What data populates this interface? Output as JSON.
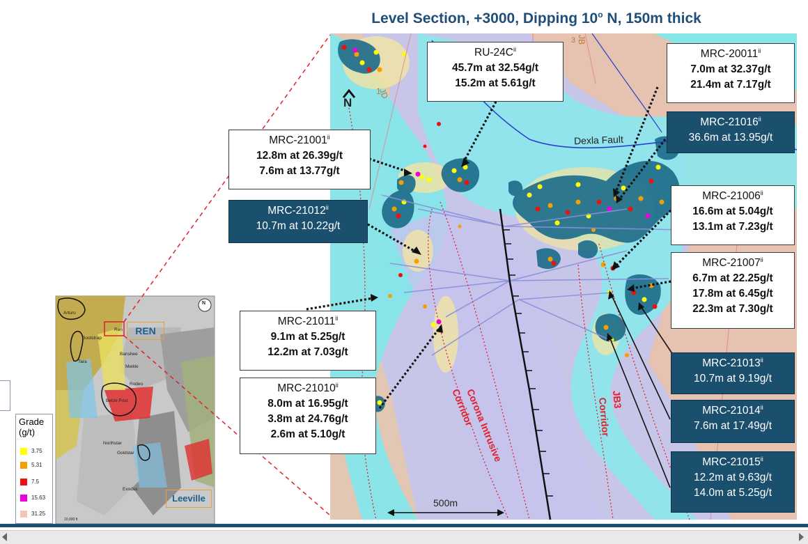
{
  "title": "Level Section, +3000, Dipping 10",
  "title_sup": "o",
  "title_tail": " N, 150m thick",
  "north_label": "N",
  "scale_label": "500m",
  "fault_label": "Dexla Fault",
  "corridor_labels": {
    "corona_1": "Corona Intrusive",
    "corona_2": "Corridor",
    "jb3_1": "JB3",
    "jb3_2": "Corridor",
    "jd": "JD",
    "jd_num": "1",
    "jb": "JB",
    "jb_num": "3"
  },
  "inset": {
    "ren_label": "REN",
    "leeville_label": "Leeville",
    "place_labels": [
      "Arturo",
      "Bootstrap",
      "Tara",
      "Ren",
      "Banshee",
      "Meikle",
      "Rodeo",
      "Betze Post",
      "Northstar",
      "Goldstar",
      "Exodus"
    ],
    "north_symbol": "N",
    "scale_text": "10,000 ft"
  },
  "legend": {
    "title_1": "Grade",
    "title_2": "(g/t)",
    "items": [
      {
        "label": "3.75",
        "color": "#ffff00"
      },
      {
        "label": "5.31",
        "color": "#f5a000"
      },
      {
        "label": "7.5",
        "color": "#ee1111"
      },
      {
        "label": "15.63",
        "color": "#ee00dd"
      },
      {
        "label": "31.25",
        "color": "#f4c6b8"
      }
    ]
  },
  "callouts": [
    {
      "id": "ru24c",
      "name": "RU-24C",
      "sup": "ii",
      "lines": [
        "45.7m at 32.54g/t",
        "15.2m at 5.61g/t"
      ],
      "style": "light"
    },
    {
      "id": "mrc20011",
      "name": "MRC-20011",
      "sup": "ii",
      "lines": [
        "7.0m at 32.37g/t",
        "21.4m at 7.17g/t"
      ],
      "style": "light"
    },
    {
      "id": "mrc21001",
      "name": "MRC-21001",
      "sup": "ii",
      "lines": [
        "12.8m at 26.39g/t",
        "7.6m at 13.77g/t"
      ],
      "style": "light"
    },
    {
      "id": "mrc21016",
      "name": "MRC-21016",
      "sup": "ii",
      "lines": [
        "36.6m at 13.95g/t"
      ],
      "style": "dark"
    },
    {
      "id": "mrc21012",
      "name": "MRC-21012",
      "sup": "ii",
      "lines": [
        "10.7m at 10.22g/t"
      ],
      "style": "dark"
    },
    {
      "id": "mrc21006",
      "name": "MRC-21006",
      "sup": "ii",
      "lines": [
        "16.6m at 5.04g/t",
        "13.1m at 7.23g/t"
      ],
      "style": "light"
    },
    {
      "id": "mrc21007",
      "name": "MRC-21007",
      "sup": "ii",
      "lines": [
        "6.7m at 22.25g/t",
        "17.8m at 6.45g/t",
        "22.3m at 7.30g/t"
      ],
      "style": "light"
    },
    {
      "id": "mrc21011",
      "name": "MRC-21011",
      "sup": "ii",
      "lines": [
        "9.1m at 5.25g/t",
        "12.2m at 7.03g/t"
      ],
      "style": "light"
    },
    {
      "id": "mrc21013",
      "name": "MRC-21013",
      "sup": "ii",
      "lines": [
        "10.7m at 9.19g/t"
      ],
      "style": "dark"
    },
    {
      "id": "mrc21010",
      "name": "MRC-21010",
      "sup": "ii",
      "lines": [
        "8.0m at 16.95g/t",
        "3.8m at 24.76g/t",
        "2.6m at 5.10g/t"
      ],
      "style": "light"
    },
    {
      "id": "mrc21014",
      "name": "MRC-21014",
      "sup": "ii",
      "lines": [
        "7.6m at 17.49g/t"
      ],
      "style": "dark"
    },
    {
      "id": "mrc21015",
      "name": "MRC-21015",
      "sup": "ii",
      "lines": [
        "12.2m at 9.63g/t",
        "14.0m at 5.25g/t"
      ],
      "style": "dark"
    }
  ]
}
